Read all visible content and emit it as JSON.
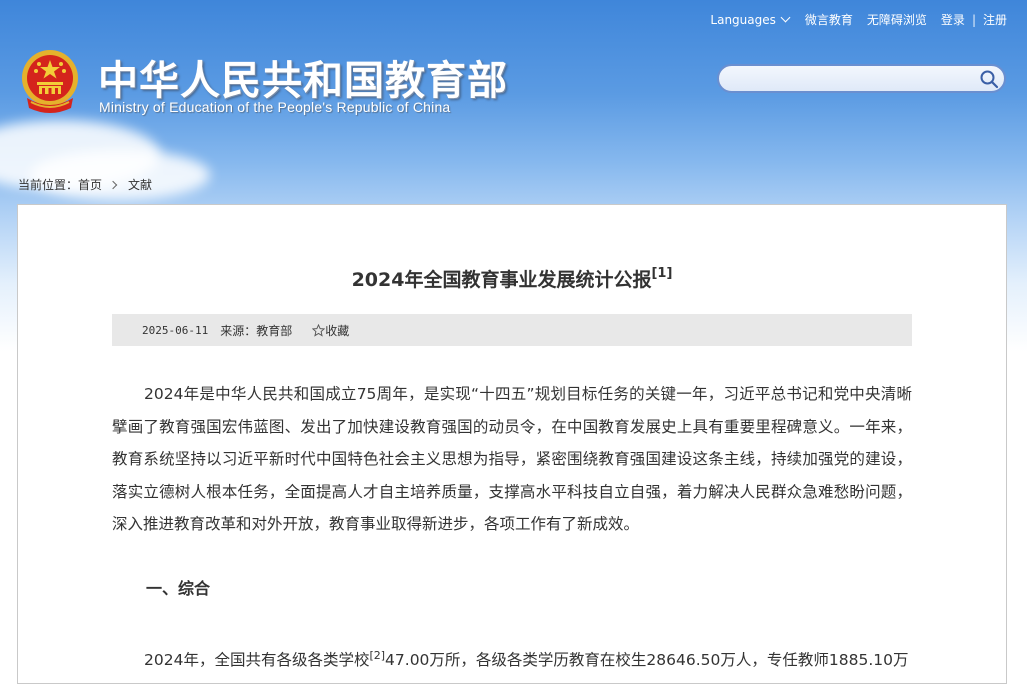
{
  "header": {
    "languages_label": "Languages",
    "links": [
      "微言教育",
      "无障碍浏览"
    ],
    "login": "登录",
    "register": "注册",
    "separator": "|",
    "title_cn": "中华人民共和国教育部",
    "title_en": "Ministry of Education of the People's Republic of China",
    "search_placeholder": ""
  },
  "breadcrumb": {
    "label": "当前位置：",
    "home": "首页",
    "current": "文献"
  },
  "article": {
    "title": "2024年全国教育事业发展统计公报",
    "title_note": "[1]",
    "date": "2025-06-11",
    "source": "来源：教育部",
    "favorite": "收藏",
    "p1": "2024年是中华人民共和国成立75周年，是实现“十四五”规划目标任务的关键一年，习近平总书记和党中央清晰擘画了教育强国宏伟蓝图、发出了加快建设教育强国的动员令，在中国教育发展史上具有重要里程碑意义。一年来，教育系统坚持以习近平新时代中国特色社会主义思想为指导，紧密围绕教育强国建设这条主线，持续加强党的建设，落实立德树人根本任务，全面提高人才自主培养质量，支撑高水平科技自立自强，着力解决人民群众急难愁盼问题，深入推进教育改革和对外开放，教育事业取得新进步，各项工作有了新成效。",
    "section1": "一、综合",
    "p2_before": "2024年，全国共有各级各类学校",
    "p2_note": "[2]",
    "p2_after": "47.00万所，各级各类学历教育在校生28646.50万人，专任教师1885.10万"
  },
  "colors": {
    "sky_top": "#3f86da",
    "text": "#333333",
    "meta_bg": "#e8e8e8",
    "search_border": "#6a8fd0"
  },
  "icons": [
    "national-emblem-icon",
    "search-icon",
    "chevron-down-icon",
    "star-icon",
    "breadcrumb-arrow-icon"
  ]
}
